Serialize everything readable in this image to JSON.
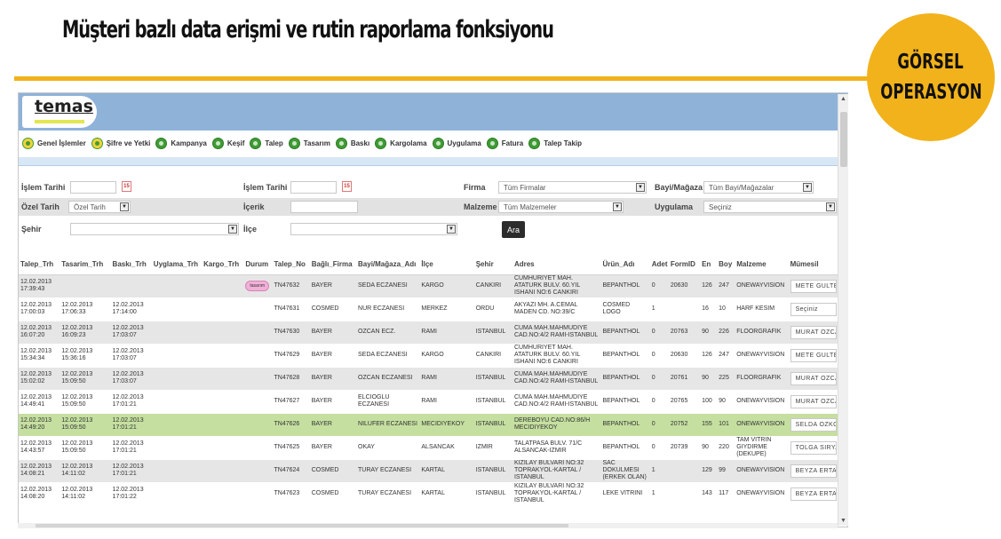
{
  "slide": {
    "title": "Müşteri bazlı data erişmi ve rutin raporlama fonksiyonu",
    "badge_line1": "GÖRSEL",
    "badge_line2": "OPERASYON",
    "accent_color": "#f2b21b"
  },
  "app": {
    "logo": "temas",
    "header_color": "#8fb2d9"
  },
  "menu": [
    {
      "label": "Genel İşlemler",
      "icon": "info-icon"
    },
    {
      "label": "Şifre ve Yetki",
      "icon": "info-icon"
    },
    {
      "label": "Kampanya",
      "icon": "check-icon"
    },
    {
      "label": "Keşif",
      "icon": "check-icon"
    },
    {
      "label": "Talep",
      "icon": "check-icon"
    },
    {
      "label": "Tasarım",
      "icon": "check-icon"
    },
    {
      "label": "Baskı",
      "icon": "check-icon"
    },
    {
      "label": "Kargolama",
      "icon": "check-icon"
    },
    {
      "label": "Uygulama",
      "icon": "check-icon"
    },
    {
      "label": "Fatura",
      "icon": "check-icon"
    },
    {
      "label": "Talep Takip",
      "icon": "check-icon"
    }
  ],
  "filters": {
    "islem_tarihi_label": "İşlem Tarihi",
    "islem_tarihi2_label": "İşlem Tarihi",
    "firma_label": "Firma",
    "firma_value": "Tüm Firmalar",
    "bayi_label": "Bayi/Mağaza",
    "bayi_value": "Tüm Bayi/Mağazalar",
    "ozel_tarih_label": "Özel Tarih",
    "ozel_tarih_value": "Özel Tarih",
    "icerik_label": "İçerik",
    "malzeme_label": "Malzeme",
    "malzeme_value": "Tüm Malzemeler",
    "uygulama_label": "Uygulama",
    "uygulama_value": "Seçiniz",
    "sehir_label": "Şehir",
    "ilce_label": "İlçe",
    "search_button": "Ara",
    "calendar_glyph": "15"
  },
  "table": {
    "columns": [
      "Talep_Trh",
      "Tasarim_Trh",
      "Baskı_Trh",
      "Uyglama_Trh",
      "Kargo_Trh",
      "Durum",
      "Talep_No",
      "Bağlı_Firma",
      "Bayi/Mağaza_Adı",
      "İlçe",
      "Şehir",
      "Adres",
      "Ürün_Adı",
      "Adet",
      "FormID",
      "En",
      "Boy",
      "Malzeme",
      "Mümesil"
    ],
    "rows": [
      {
        "talep_trh": "12.02.2013 17:39:43",
        "tasarim_trh": "",
        "baski_trh": "",
        "uygulama_trh": "",
        "kargo_trh": "",
        "durum": "tasarım",
        "talep_no": "TN47632",
        "firma": "BAYER",
        "bayi": "SEDA ECZANESI",
        "ilce": "KARGO",
        "sehir": "CANKIRI",
        "adres": "CUMHURIYET MAH. ATATURK BULV. 60.YIL ISHANI NO:6 CANKIRI",
        "urun": "BEPANTHOL",
        "adet": "0",
        "formid": "20630",
        "en": "126",
        "boy": "247",
        "malzeme": "ONEWAYVISION",
        "mumesil": "METE GULTEKIN"
      },
      {
        "talep_trh": "12.02.2013 17:00:03",
        "tasarim_trh": "12.02.2013 17:06:33",
        "baski_trh": "12.02.2013 17:14:00",
        "uygulama_trh": "",
        "kargo_trh": "",
        "durum": "",
        "talep_no": "TN47631",
        "firma": "COSMED",
        "bayi": "NUR ECZANESI",
        "ilce": "MERKEZ",
        "sehir": "ORDU",
        "adres": "AKYAZI MH. A.CEMAL MADEN CD. NO:39/C",
        "urun": "COSMED LOGO",
        "adet": "1",
        "formid": "",
        "en": "16",
        "boy": "10",
        "malzeme": "HARF KESIM",
        "mumesil": "Seçiniz"
      },
      {
        "talep_trh": "12.02.2013 16:07:20",
        "tasarim_trh": "12.02.2013 16:09:23",
        "baski_trh": "12.02.2013 17:03:07",
        "uygulama_trh": "",
        "kargo_trh": "",
        "durum": "",
        "talep_no": "TN47630",
        "firma": "BAYER",
        "bayi": "OZCAN ECZ.",
        "ilce": "RAMI",
        "sehir": "ISTANBUL",
        "adres": "CUMA MAH.MAHMUDIYE CAD.NO:4/2 RAMI-ISTANBUL",
        "urun": "BEPANTHOL",
        "adet": "0",
        "formid": "20763",
        "en": "90",
        "boy": "226",
        "malzeme": "FLOORGRAFIK",
        "mumesil": "MURAT OZCAN"
      },
      {
        "talep_trh": "12.02.2013 15:34:34",
        "tasarim_trh": "12.02.2013 15:36:16",
        "baski_trh": "12.02.2013 17:03:07",
        "uygulama_trh": "",
        "kargo_trh": "",
        "durum": "",
        "talep_no": "TN47629",
        "firma": "BAYER",
        "bayi": "SEDA ECZANESI",
        "ilce": "KARGO",
        "sehir": "CANKIRI",
        "adres": "CUMHURIYET MAH. ATATURK BULV. 60.YIL ISHANI NO:6 CANKIRI",
        "urun": "BEPANTHOL",
        "adet": "0",
        "formid": "20630",
        "en": "126",
        "boy": "247",
        "malzeme": "ONEWAYVISION",
        "mumesil": "METE GULTEKIN"
      },
      {
        "talep_trh": "12.02.2013 15:02:02",
        "tasarim_trh": "12.02.2013 15:09:50",
        "baski_trh": "12.02.2013 17:03:07",
        "uygulama_trh": "",
        "kargo_trh": "",
        "durum": "",
        "talep_no": "TN47628",
        "firma": "BAYER",
        "bayi": "OZCAN ECZANESI",
        "ilce": "RAMI",
        "sehir": "ISTANBUL",
        "adres": "CUMA MAH.MAHMUDIYE CAD.NO:4/2 RAMI-ISTANBUL",
        "urun": "BEPANTHOL",
        "adet": "0",
        "formid": "20761",
        "en": "90",
        "boy": "225",
        "malzeme": "FLOORGRAFIK",
        "mumesil": "MURAT OZCAN"
      },
      {
        "talep_trh": "12.02.2013 14:49:41",
        "tasarim_trh": "12.02.2013 15:09:50",
        "baski_trh": "12.02.2013 17:01:21",
        "uygulama_trh": "",
        "kargo_trh": "",
        "durum": "",
        "talep_no": "TN47627",
        "firma": "BAYER",
        "bayi": "ELCIOGLU ECZANESI",
        "ilce": "RAMI",
        "sehir": "ISTANBUL",
        "adres": "CUMA MAH.MAHMUDIYE CAD.NO:4/2 RAMI-ISTANBUL",
        "urun": "BEPANTHOL",
        "adet": "0",
        "formid": "20765",
        "en": "100",
        "boy": "90",
        "malzeme": "ONEWAYVISION",
        "mumesil": "MURAT OZCAN"
      },
      {
        "talep_trh": "12.02.2013 14:49:20",
        "tasarim_trh": "12.02.2013 15:09:50",
        "baski_trh": "12.02.2013 17:01:21",
        "uygulama_trh": "",
        "kargo_trh": "",
        "durum": "",
        "talep_no": "TN47626",
        "firma": "BAYER",
        "bayi": "NILUFER ECZANESI",
        "ilce": "MECIDIYEKOY",
        "sehir": "ISTANBUL",
        "adres": "DEREBOYU CAD.NO:86/H MECIDIYEKOY",
        "urun": "BEPANTHOL",
        "adet": "0",
        "formid": "20752",
        "en": "155",
        "boy": "101",
        "malzeme": "ONEWAYVISION",
        "mumesil": "SELDA OZKOK"
      },
      {
        "talep_trh": "12.02.2013 14:43:57",
        "tasarim_trh": "12.02.2013 15:09:50",
        "baski_trh": "12.02.2013 17:01:21",
        "uygulama_trh": "",
        "kargo_trh": "",
        "durum": "",
        "talep_no": "TN47625",
        "firma": "BAYER",
        "bayi": "OKAY",
        "ilce": "ALSANCAK",
        "sehir": "IZMIR",
        "adres": "TALATPASA BULV. 71/C ALSANCAK-IZMIR",
        "urun": "BEPANTHOL",
        "adet": "0",
        "formid": "20739",
        "en": "90",
        "boy": "220",
        "malzeme": "TAM VITRIN GIYDIRME (DEKUPE)",
        "mumesil": "TOLGA SIRYAN"
      },
      {
        "talep_trh": "12.02.2013 14:08:21",
        "tasarim_trh": "12.02.2013 14:11:02",
        "baski_trh": "12.02.2013 17:01:21",
        "uygulama_trh": "",
        "kargo_trh": "",
        "durum": "",
        "talep_no": "TN47624",
        "firma": "COSMED",
        "bayi": "TURAY ECZANESI",
        "ilce": "KARTAL",
        "sehir": "ISTANBUL",
        "adres": "KIZILAY BULVARI NO:32 TOPRAKYOL-KARTAL / ISTANBUL",
        "urun": "SAC DOKULMESI (ERKEK OLAN)",
        "adet": "1",
        "formid": "",
        "en": "129",
        "boy": "99",
        "malzeme": "ONEWAYVISION",
        "mumesil": "BEYZA ERTAS"
      },
      {
        "talep_trh": "12.02.2013 14:08:20",
        "tasarim_trh": "12.02.2013 14:11:02",
        "baski_trh": "12.02.2013 17:01:22",
        "uygulama_trh": "",
        "kargo_trh": "",
        "durum": "",
        "talep_no": "TN47623",
        "firma": "COSMED",
        "bayi": "TURAY ECZANESI",
        "ilce": "KARTAL",
        "sehir": "ISTANBUL",
        "adres": "KIZILAY BULVARI NO:32 TOPRAKYOL-KARTAL / ISTANBUL",
        "urun": "LEKE VITRINI",
        "adet": "1",
        "formid": "",
        "en": "143",
        "boy": "117",
        "malzeme": "ONEWAYVISION",
        "mumesil": "BEYZA ERTAS"
      }
    ],
    "selected_row": 6
  }
}
